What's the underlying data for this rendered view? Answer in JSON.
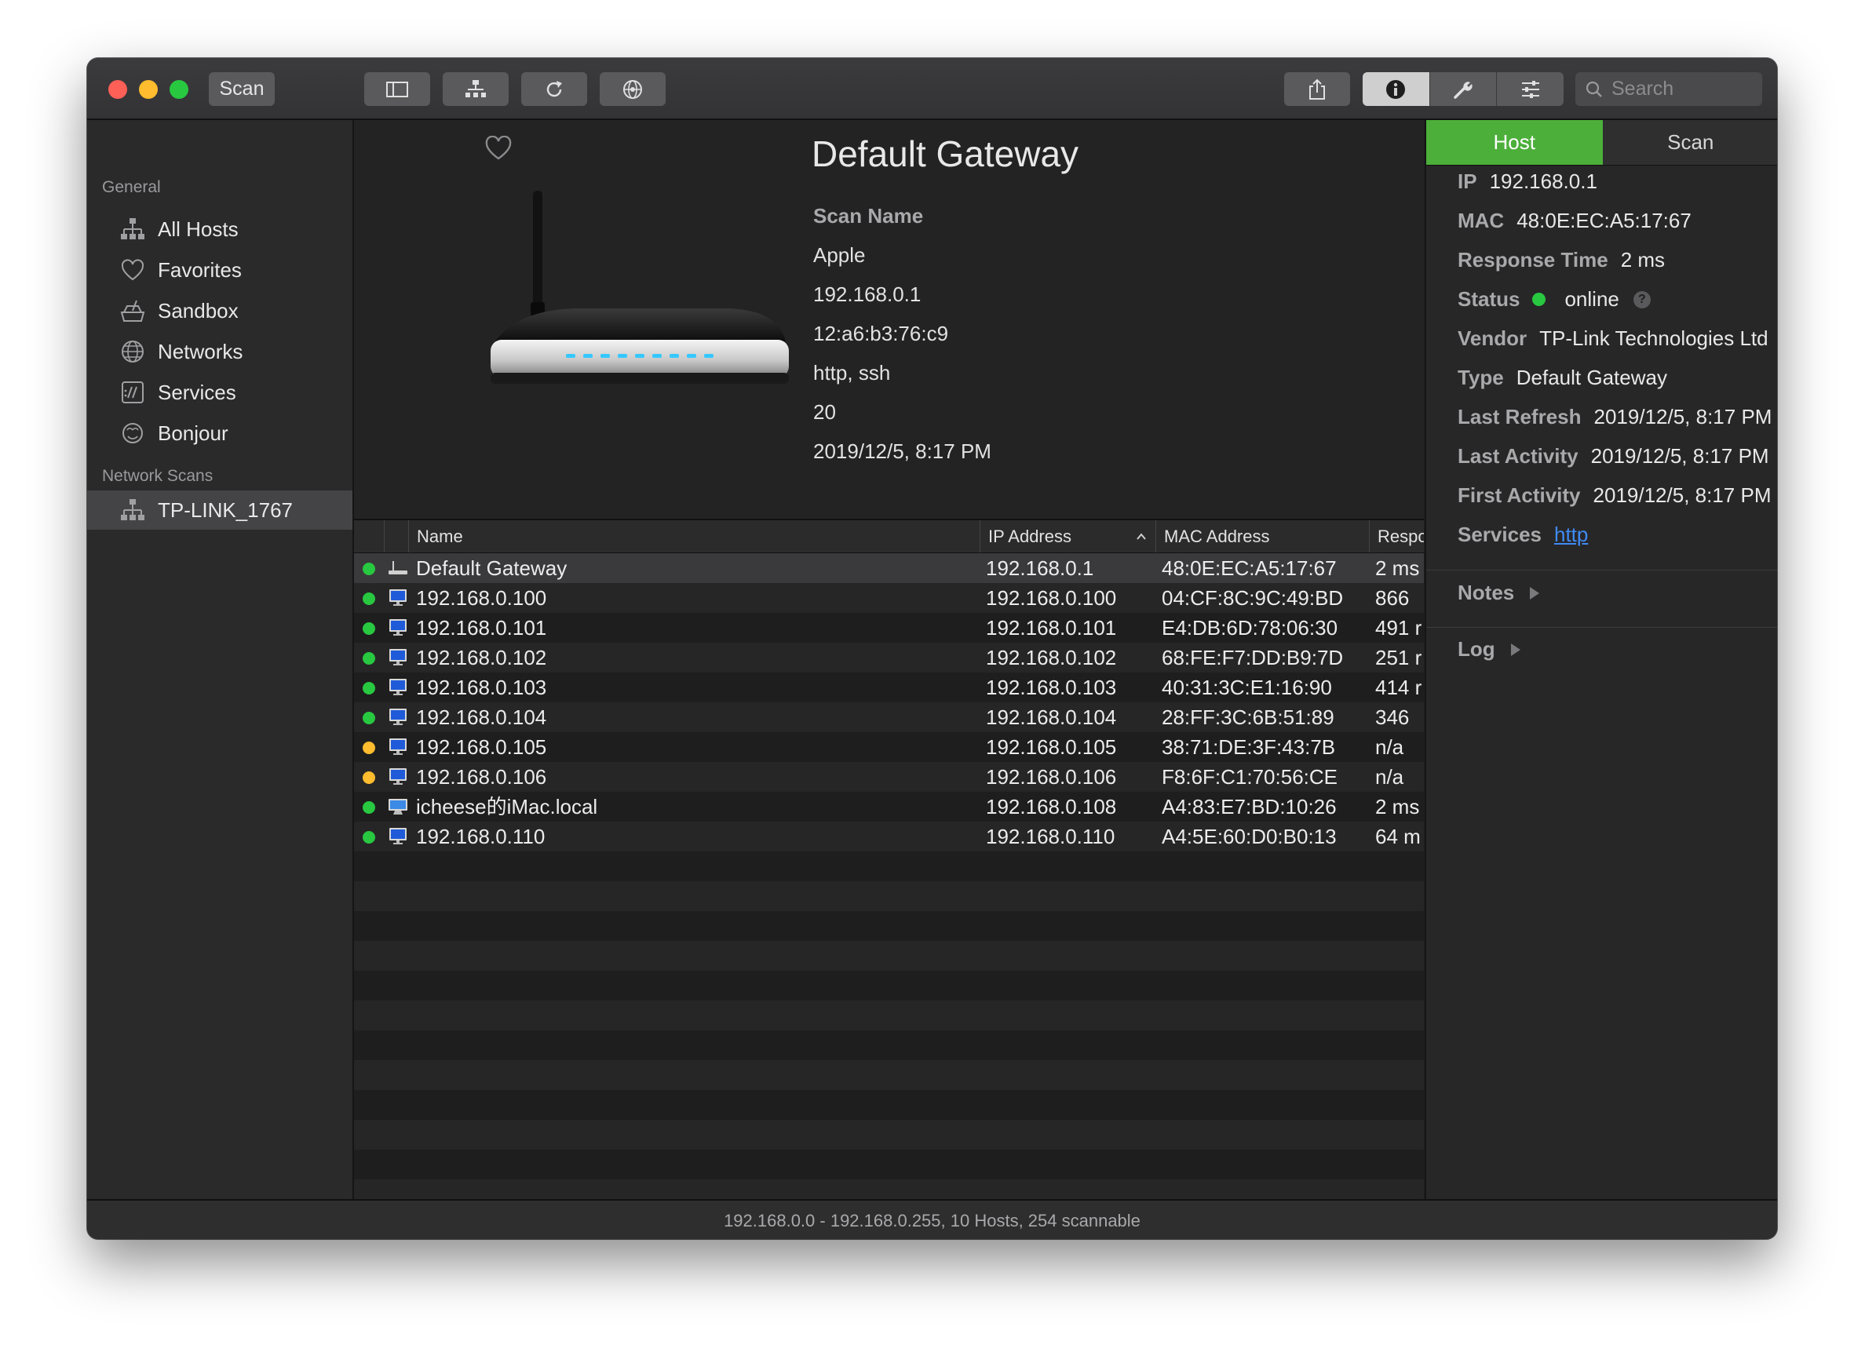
{
  "toolbar": {
    "scan_label": "Scan",
    "search_placeholder": "Search"
  },
  "sidebar": {
    "general_label": "General",
    "items": [
      {
        "label": "All Hosts",
        "icon": "network-tree-icon"
      },
      {
        "label": "Favorites",
        "icon": "heart-icon"
      },
      {
        "label": "Sandbox",
        "icon": "sandbox-icon"
      },
      {
        "label": "Networks",
        "icon": "globe-icon"
      },
      {
        "label": "Services",
        "icon": "services-icon"
      },
      {
        "label": "Bonjour",
        "icon": "bonjour-icon"
      }
    ],
    "network_scans_label": "Network Scans",
    "scans": [
      {
        "label": "TP-LINK_1767",
        "icon": "network-tree-icon"
      }
    ]
  },
  "detail": {
    "title": "Default Gateway",
    "scan_name_label": "Scan Name",
    "lines": [
      "Apple",
      "192.168.0.1",
      "12:a6:b3:76:c9",
      "http, ssh",
      "20",
      "2019/12/5, 8:17 PM"
    ]
  },
  "table": {
    "columns": [
      "Name",
      "IP Address",
      "MAC Address",
      "Respo"
    ],
    "rows": [
      {
        "name": "Default Gateway",
        "ip": "192.168.0.1",
        "mac": "48:0E:EC:A5:17:67",
        "resp": "2 ms",
        "status": "green",
        "icon": "router",
        "selected": true
      },
      {
        "name": "192.168.0.100",
        "ip": "192.168.0.100",
        "mac": "04:CF:8C:9C:49:BD",
        "resp": "866",
        "status": "green",
        "icon": "monitor"
      },
      {
        "name": "192.168.0.101",
        "ip": "192.168.0.101",
        "mac": "E4:DB:6D:78:06:30",
        "resp": "491 r",
        "status": "green",
        "icon": "monitor"
      },
      {
        "name": "192.168.0.102",
        "ip": "192.168.0.102",
        "mac": "68:FE:F7:DD:B9:7D",
        "resp": "251 r",
        "status": "green",
        "icon": "monitor"
      },
      {
        "name": "192.168.0.103",
        "ip": "192.168.0.103",
        "mac": "40:31:3C:E1:16:90",
        "resp": "414 r",
        "status": "green",
        "icon": "monitor"
      },
      {
        "name": "192.168.0.104",
        "ip": "192.168.0.104",
        "mac": "28:FF:3C:6B:51:89",
        "resp": "346",
        "status": "green",
        "icon": "monitor"
      },
      {
        "name": "192.168.0.105",
        "ip": "192.168.0.105",
        "mac": "38:71:DE:3F:43:7B",
        "resp": "n/a",
        "status": "orange",
        "icon": "monitor"
      },
      {
        "name": "192.168.0.106",
        "ip": "192.168.0.106",
        "mac": "F8:6F:C1:70:56:CE",
        "resp": "n/a",
        "status": "orange",
        "icon": "monitor"
      },
      {
        "name": "icheese的iMac.local",
        "ip": "192.168.0.108",
        "mac": "A4:83:E7:BD:10:26",
        "resp": "2 ms",
        "status": "green",
        "icon": "imac"
      },
      {
        "name": "192.168.0.110",
        "ip": "192.168.0.110",
        "mac": "A4:5E:60:D0:B0:13",
        "resp": "64 m",
        "status": "green",
        "icon": "monitor"
      }
    ]
  },
  "panel": {
    "tabs": [
      "Host",
      "Scan"
    ],
    "ip_label": "IP",
    "ip": "192.168.0.1",
    "mac_label": "MAC",
    "mac": "48:0E:EC:A5:17:67",
    "response_label": "Response Time",
    "response": "2 ms",
    "status_label": "Status",
    "status": "online",
    "help": "?",
    "vendor_label": "Vendor",
    "vendor": "TP-Link Technologies Ltd",
    "type_label": "Type",
    "type": "Default Gateway",
    "last_refresh_label": "Last Refresh",
    "last_refresh": "2019/12/5, 8:17 PM",
    "last_activity_label": "Last Activity",
    "last_activity": "2019/12/5, 8:17 PM",
    "first_activity_label": "First Activity",
    "first_activity": "2019/12/5, 8:17 PM",
    "services_label": "Services",
    "services": "http",
    "notes_label": "Notes",
    "log_label": "Log"
  },
  "statusbar": {
    "text": "192.168.0.0 - 192.168.0.255, 10 Hosts, 254 scannable"
  },
  "colors": {
    "accent_green": "#4caf3a",
    "status_green": "#28c840",
    "status_orange": "#febc2e",
    "link": "#3f8bf5"
  }
}
